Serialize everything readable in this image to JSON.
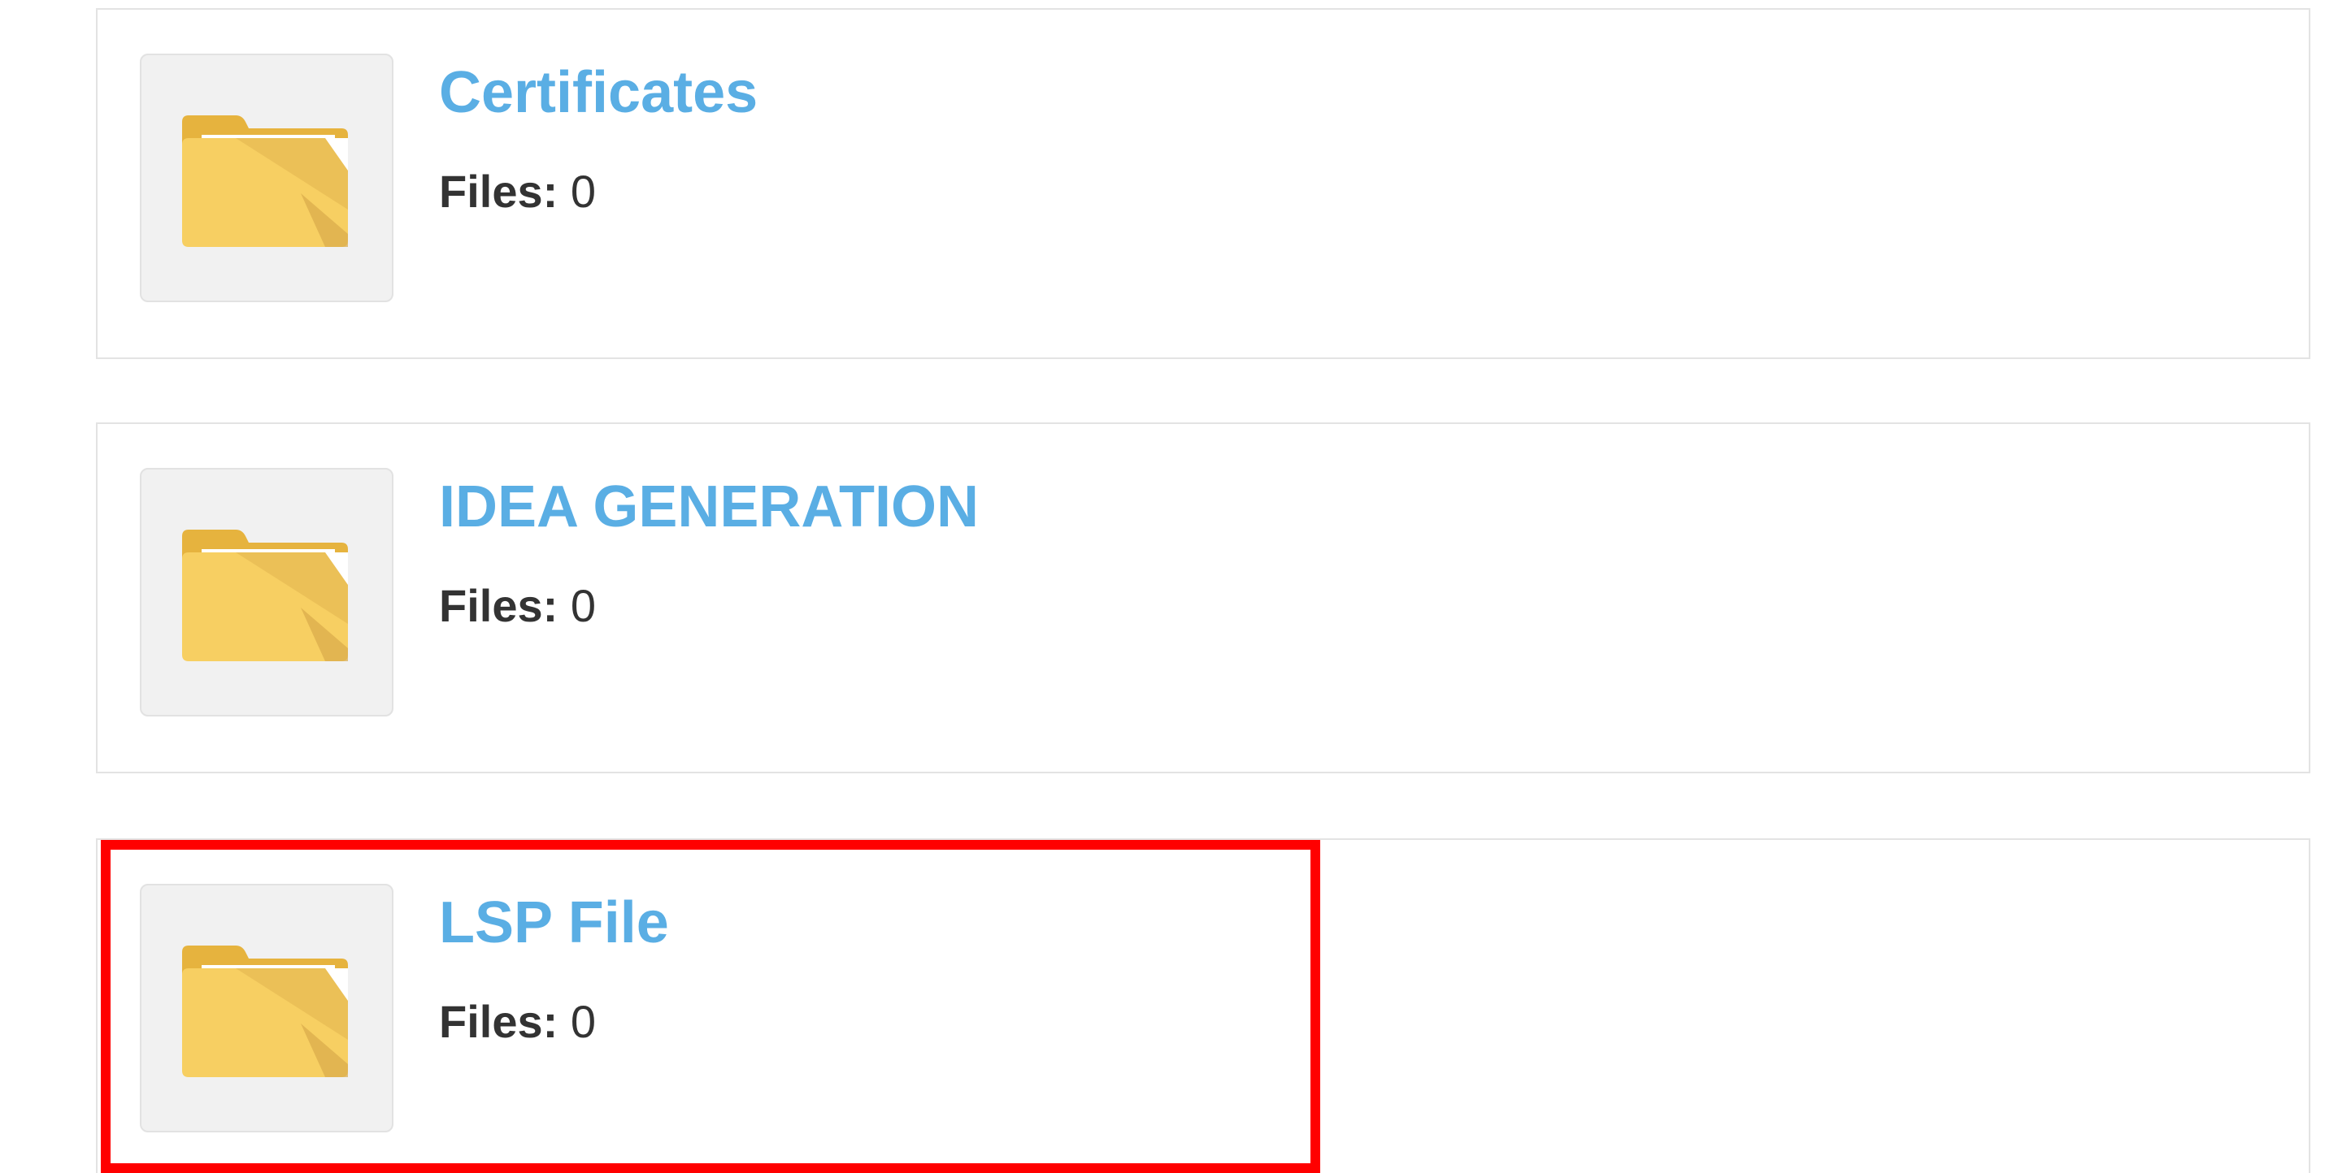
{
  "folders": [
    {
      "title": "Certificates",
      "files_label": "Files:",
      "files_count": "0",
      "icon": "folder-icon"
    },
    {
      "title": "IDEA GENERATION",
      "files_label": "Files:",
      "files_count": "0",
      "icon": "folder-icon"
    },
    {
      "title": "LSP File",
      "files_label": "Files:",
      "files_count": "0",
      "icon": "folder-icon",
      "highlighted": true
    }
  ],
  "colors": {
    "title_link": "#5aaee4",
    "highlight_border": "#ff0000",
    "folder_yellow": "#f7cf62"
  }
}
